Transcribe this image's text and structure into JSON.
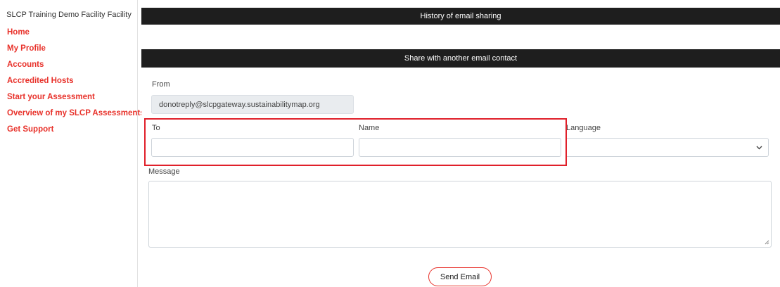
{
  "sidebar": {
    "facility_name": "SLCP Training Demo Facility Facility",
    "items": [
      {
        "label": "Home"
      },
      {
        "label": "My Profile"
      },
      {
        "label": "Accounts"
      },
      {
        "label": "Accredited Hosts"
      },
      {
        "label": "Start your Assessment"
      },
      {
        "label": "Overview of my SLCP Assessments"
      },
      {
        "label": "Get Support"
      }
    ]
  },
  "history": {
    "title": "History of email sharing"
  },
  "share": {
    "title": "Share with another email contact",
    "from_label": "From",
    "from_value": "donotreply@slcpgateway.sustainabilitymap.org",
    "to_label": "To",
    "to_value": "",
    "name_label": "Name",
    "name_value": "",
    "language_label": "Language",
    "language_value": "",
    "message_label": "Message",
    "message_value": "",
    "send_label": "Send Email"
  },
  "colors": {
    "accent": "#e8322b",
    "header_bg": "#1e1e1e",
    "highlight": "#e0202a"
  }
}
